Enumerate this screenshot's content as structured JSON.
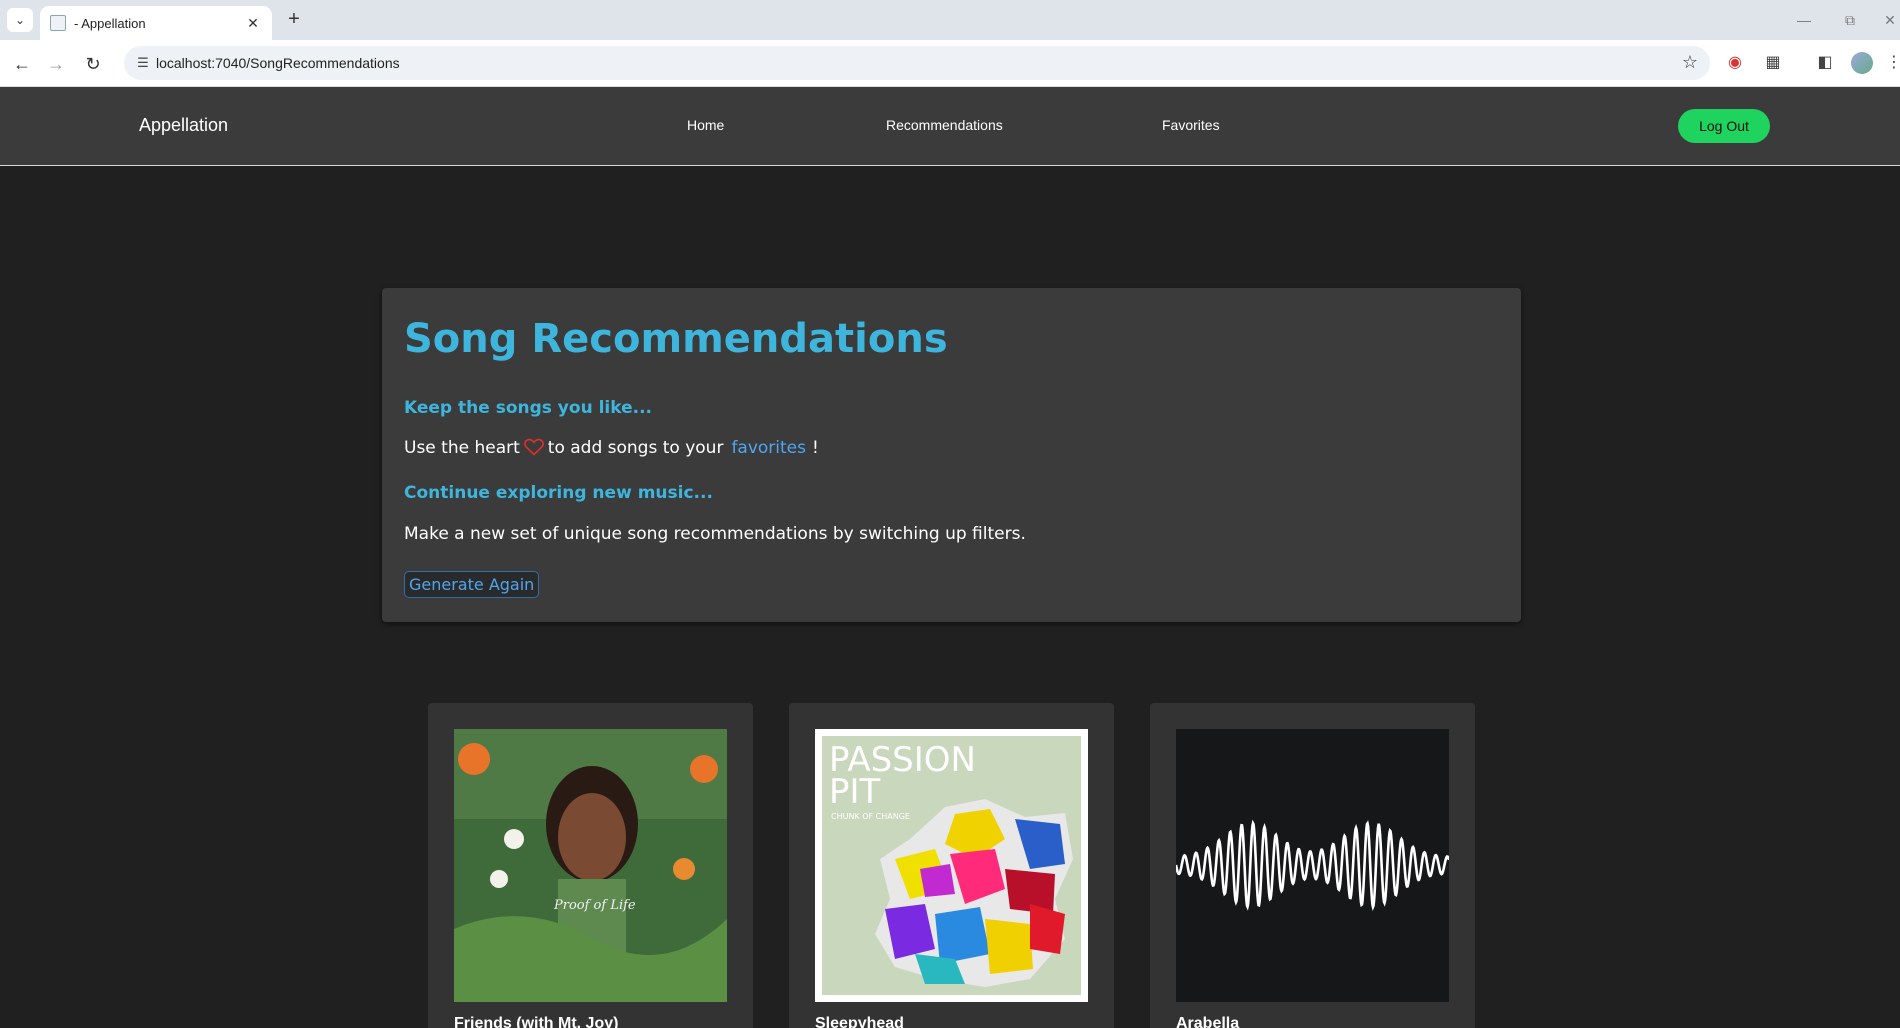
{
  "browser": {
    "tab_title": "- Appellation",
    "url": "localhost:7040/SongRecommendations"
  },
  "nav": {
    "brand": "Appellation",
    "links": [
      "Home",
      "Recommendations",
      "Favorites"
    ],
    "logout_label": "Log Out"
  },
  "main": {
    "title": "Song Recommendations",
    "keep_heading": "Keep the songs you like...",
    "keep_text_before": "Use the heart",
    "keep_text_middle": "to add songs to your",
    "favorites_link": "favorites",
    "keep_text_end": "!",
    "explore_heading": "Continue exploring new music...",
    "explore_text": "Make a new set of unique song recommendations by switching up filters.",
    "generate_label": "Generate Again"
  },
  "songs": [
    {
      "title": "Friends (with Mt. Joy)",
      "art_text": "Proof of Life"
    },
    {
      "title": "Sleepyhead",
      "art_text_1": "PASSION",
      "art_text_2": "PIT",
      "art_text_3": "CHUNK OF CHANGE"
    },
    {
      "title": "Arabella"
    }
  ],
  "colors": {
    "accent": "#3db5dc",
    "link": "#4fa6f0",
    "logout": "#1ed35e",
    "heart": "#e0312b"
  }
}
